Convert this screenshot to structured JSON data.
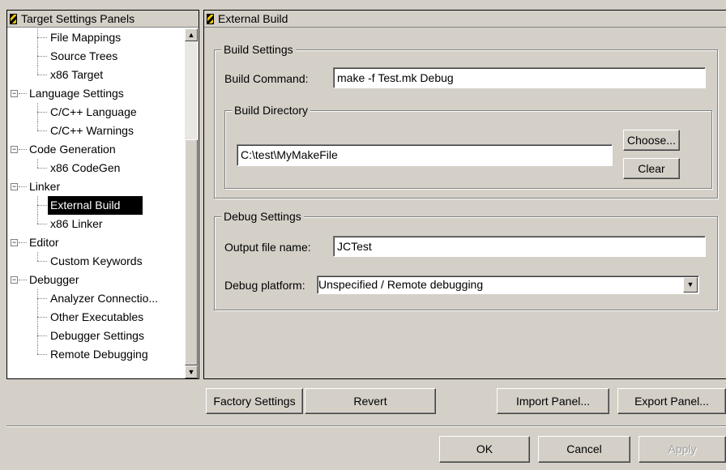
{
  "tree": {
    "header": "Target Settings Panels",
    "items": [
      {
        "label": "File Mappings",
        "level": 1
      },
      {
        "label": "Source Trees",
        "level": 1
      },
      {
        "label": "x86 Target",
        "level": 1
      },
      {
        "label": "Language Settings",
        "level": 0
      },
      {
        "label": "C/C++ Language",
        "level": 1
      },
      {
        "label": "C/C++ Warnings",
        "level": 1
      },
      {
        "label": "Code Generation",
        "level": 0
      },
      {
        "label": "x86 CodeGen",
        "level": 1
      },
      {
        "label": "Linker",
        "level": 0
      },
      {
        "label": "External Build",
        "level": 1,
        "selected": true
      },
      {
        "label": "x86 Linker",
        "level": 1
      },
      {
        "label": "Editor",
        "level": 0
      },
      {
        "label": "Custom Keywords",
        "level": 1
      },
      {
        "label": "Debugger",
        "level": 0
      },
      {
        "label": "Analyzer Connectio...",
        "level": 1
      },
      {
        "label": "Other Executables",
        "level": 1
      },
      {
        "label": "Debugger Settings",
        "level": 1
      },
      {
        "label": "Remote Debugging",
        "level": 1
      }
    ]
  },
  "panel": {
    "header": "External Build",
    "build_settings": {
      "title": "Build Settings",
      "command_label": "Build Command:",
      "command_value": "make -f Test.mk Debug",
      "directory": {
        "title": "Build Directory",
        "value": "C:\\test\\MyMakeFile",
        "choose_label": "Choose...",
        "clear_label": "Clear"
      }
    },
    "debug_settings": {
      "title": "Debug Settings",
      "output_label": "Output file name:",
      "output_value": "JCTest",
      "platform_label": "Debug platform:",
      "platform_value": "Unspecified / Remote debugging"
    }
  },
  "buttons": {
    "factory_settings": "Factory Settings",
    "revert": "Revert",
    "import_panel": "Import Panel...",
    "export_panel": "Export Panel...",
    "ok": "OK",
    "cancel": "Cancel",
    "apply": "Apply"
  },
  "icons": {
    "panel_header": "settings-panel-icon",
    "tree_expand": "minus-box-icon",
    "dropdown": "chevron-down-icon"
  }
}
